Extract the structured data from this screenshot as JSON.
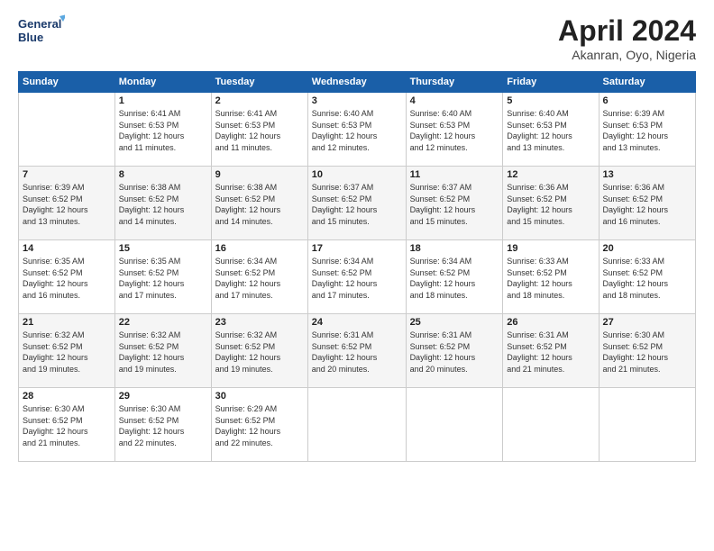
{
  "header": {
    "logo_line1": "General",
    "logo_line2": "Blue",
    "month_title": "April 2024",
    "subtitle": "Akanran, Oyo, Nigeria"
  },
  "weekdays": [
    "Sunday",
    "Monday",
    "Tuesday",
    "Wednesday",
    "Thursday",
    "Friday",
    "Saturday"
  ],
  "weeks": [
    [
      {
        "day": "",
        "detail": ""
      },
      {
        "day": "1",
        "detail": "Sunrise: 6:41 AM\nSunset: 6:53 PM\nDaylight: 12 hours\nand 11 minutes."
      },
      {
        "day": "2",
        "detail": "Sunrise: 6:41 AM\nSunset: 6:53 PM\nDaylight: 12 hours\nand 11 minutes."
      },
      {
        "day": "3",
        "detail": "Sunrise: 6:40 AM\nSunset: 6:53 PM\nDaylight: 12 hours\nand 12 minutes."
      },
      {
        "day": "4",
        "detail": "Sunrise: 6:40 AM\nSunset: 6:53 PM\nDaylight: 12 hours\nand 12 minutes."
      },
      {
        "day": "5",
        "detail": "Sunrise: 6:40 AM\nSunset: 6:53 PM\nDaylight: 12 hours\nand 13 minutes."
      },
      {
        "day": "6",
        "detail": "Sunrise: 6:39 AM\nSunset: 6:53 PM\nDaylight: 12 hours\nand 13 minutes."
      }
    ],
    [
      {
        "day": "7",
        "detail": "Sunrise: 6:39 AM\nSunset: 6:52 PM\nDaylight: 12 hours\nand 13 minutes."
      },
      {
        "day": "8",
        "detail": "Sunrise: 6:38 AM\nSunset: 6:52 PM\nDaylight: 12 hours\nand 14 minutes."
      },
      {
        "day": "9",
        "detail": "Sunrise: 6:38 AM\nSunset: 6:52 PM\nDaylight: 12 hours\nand 14 minutes."
      },
      {
        "day": "10",
        "detail": "Sunrise: 6:37 AM\nSunset: 6:52 PM\nDaylight: 12 hours\nand 15 minutes."
      },
      {
        "day": "11",
        "detail": "Sunrise: 6:37 AM\nSunset: 6:52 PM\nDaylight: 12 hours\nand 15 minutes."
      },
      {
        "day": "12",
        "detail": "Sunrise: 6:36 AM\nSunset: 6:52 PM\nDaylight: 12 hours\nand 15 minutes."
      },
      {
        "day": "13",
        "detail": "Sunrise: 6:36 AM\nSunset: 6:52 PM\nDaylight: 12 hours\nand 16 minutes."
      }
    ],
    [
      {
        "day": "14",
        "detail": "Sunrise: 6:35 AM\nSunset: 6:52 PM\nDaylight: 12 hours\nand 16 minutes."
      },
      {
        "day": "15",
        "detail": "Sunrise: 6:35 AM\nSunset: 6:52 PM\nDaylight: 12 hours\nand 17 minutes."
      },
      {
        "day": "16",
        "detail": "Sunrise: 6:34 AM\nSunset: 6:52 PM\nDaylight: 12 hours\nand 17 minutes."
      },
      {
        "day": "17",
        "detail": "Sunrise: 6:34 AM\nSunset: 6:52 PM\nDaylight: 12 hours\nand 17 minutes."
      },
      {
        "day": "18",
        "detail": "Sunrise: 6:34 AM\nSunset: 6:52 PM\nDaylight: 12 hours\nand 18 minutes."
      },
      {
        "day": "19",
        "detail": "Sunrise: 6:33 AM\nSunset: 6:52 PM\nDaylight: 12 hours\nand 18 minutes."
      },
      {
        "day": "20",
        "detail": "Sunrise: 6:33 AM\nSunset: 6:52 PM\nDaylight: 12 hours\nand 18 minutes."
      }
    ],
    [
      {
        "day": "21",
        "detail": "Sunrise: 6:32 AM\nSunset: 6:52 PM\nDaylight: 12 hours\nand 19 minutes."
      },
      {
        "day": "22",
        "detail": "Sunrise: 6:32 AM\nSunset: 6:52 PM\nDaylight: 12 hours\nand 19 minutes."
      },
      {
        "day": "23",
        "detail": "Sunrise: 6:32 AM\nSunset: 6:52 PM\nDaylight: 12 hours\nand 19 minutes."
      },
      {
        "day": "24",
        "detail": "Sunrise: 6:31 AM\nSunset: 6:52 PM\nDaylight: 12 hours\nand 20 minutes."
      },
      {
        "day": "25",
        "detail": "Sunrise: 6:31 AM\nSunset: 6:52 PM\nDaylight: 12 hours\nand 20 minutes."
      },
      {
        "day": "26",
        "detail": "Sunrise: 6:31 AM\nSunset: 6:52 PM\nDaylight: 12 hours\nand 21 minutes."
      },
      {
        "day": "27",
        "detail": "Sunrise: 6:30 AM\nSunset: 6:52 PM\nDaylight: 12 hours\nand 21 minutes."
      }
    ],
    [
      {
        "day": "28",
        "detail": "Sunrise: 6:30 AM\nSunset: 6:52 PM\nDaylight: 12 hours\nand 21 minutes."
      },
      {
        "day": "29",
        "detail": "Sunrise: 6:30 AM\nSunset: 6:52 PM\nDaylight: 12 hours\nand 22 minutes."
      },
      {
        "day": "30",
        "detail": "Sunrise: 6:29 AM\nSunset: 6:52 PM\nDaylight: 12 hours\nand 22 minutes."
      },
      {
        "day": "",
        "detail": ""
      },
      {
        "day": "",
        "detail": ""
      },
      {
        "day": "",
        "detail": ""
      },
      {
        "day": "",
        "detail": ""
      }
    ]
  ]
}
